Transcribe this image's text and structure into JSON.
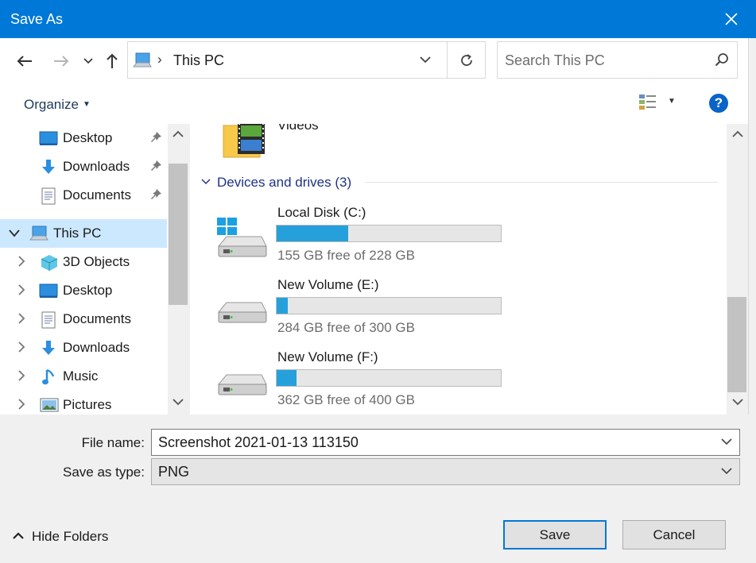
{
  "window": {
    "title": "Save As"
  },
  "nav": {
    "back_label": "Back",
    "forward_label": "Forward",
    "recent_label": "Recent locations",
    "up_label": "Up"
  },
  "address": {
    "crumb": "This PC"
  },
  "search": {
    "placeholder": "Search This PC"
  },
  "toolbar": {
    "organize": "Organize",
    "help": "?"
  },
  "navpane": {
    "quick_access": [
      {
        "label": "Desktop",
        "icon": "desktop-icon",
        "pinned": true
      },
      {
        "label": "Downloads",
        "icon": "downloads-icon",
        "pinned": true
      },
      {
        "label": "Documents",
        "icon": "documents-icon",
        "pinned": true
      }
    ],
    "this_pc": {
      "label": "This PC",
      "icon": "computer-icon"
    },
    "children": [
      {
        "label": "3D Objects",
        "icon": "3d-objects-icon"
      },
      {
        "label": "Desktop",
        "icon": "desktop-icon"
      },
      {
        "label": "Documents",
        "icon": "documents-icon"
      },
      {
        "label": "Downloads",
        "icon": "downloads-icon"
      },
      {
        "label": "Music",
        "icon": "music-icon"
      },
      {
        "label": "Pictures",
        "icon": "pictures-icon"
      }
    ]
  },
  "content": {
    "folder_partial": "Videos",
    "group_header": "Devices and drives (3)",
    "drives": [
      {
        "name": "Local Disk (C:)",
        "free": "155 GB free of 228 GB",
        "used_fraction": 0.32,
        "icon": "windows-drive-icon"
      },
      {
        "name": "New Volume (E:)",
        "free": "284 GB free of 300 GB",
        "used_fraction": 0.05,
        "icon": "drive-icon"
      },
      {
        "name": "New Volume (F:)",
        "free": "362 GB free of 400 GB",
        "used_fraction": 0.09,
        "icon": "drive-icon"
      }
    ]
  },
  "form": {
    "filename_label": "File name:",
    "filename_value": "Screenshot 2021-01-13 113150",
    "type_label": "Save as type:",
    "type_value": "PNG"
  },
  "footer": {
    "hide_folders": "Hide Folders",
    "save": "Save",
    "cancel": "Cancel"
  },
  "colors": {
    "titlebar": "#0078d7",
    "selection": "#cce8ff",
    "drive_fill": "#26a0da",
    "link": "#1e3287"
  }
}
